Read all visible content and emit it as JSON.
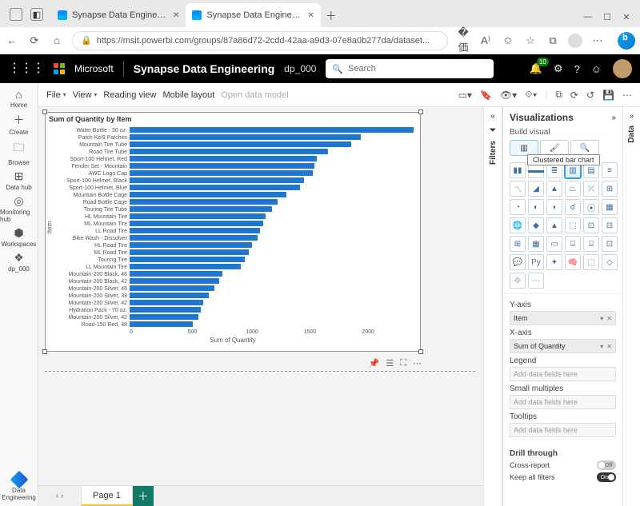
{
  "browser": {
    "tabs": [
      {
        "label": "Synapse Data Engineering",
        "active": false
      },
      {
        "label": "Synapse Data Engineering",
        "active": true
      }
    ],
    "url": "https://msit.powerbi.com/groups/87a86d72-2cdd-42aa-a9d3-07e8a0b277da/dataset..."
  },
  "app_header": {
    "brand": "Microsoft",
    "product": "Synapse Data Engineering",
    "workspace": "dp_000",
    "search_placeholder": "Search",
    "notifications": "10"
  },
  "left_rail": {
    "items": [
      {
        "icon": "⌂",
        "label": "Home"
      },
      {
        "icon": "＋",
        "label": "Create"
      },
      {
        "icon": "🗀",
        "label": "Browse"
      },
      {
        "icon": "⊞",
        "label": "Data hub"
      },
      {
        "icon": "◎",
        "label": "Monitoring hub"
      },
      {
        "icon": "⬢",
        "label": "Workspaces"
      },
      {
        "icon": "❖",
        "label": "dp_000"
      }
    ],
    "bottom_label": "Data Engineering"
  },
  "ribbon": {
    "menus": [
      "File",
      "View",
      "Reading view",
      "Mobile layout",
      "Open data model"
    ]
  },
  "filters_label": "Filters",
  "data_label": "Data",
  "viz_pane": {
    "title": "Visualizations",
    "sub": "Build visual",
    "tooltip": "Clustered bar chart",
    "yaxis_label": "Y-axis",
    "yaxis_value": "Item",
    "xaxis_label": "X-axis",
    "xaxis_value": "Sum of Quantity",
    "legend_label": "Legend",
    "placeholder": "Add data fields here",
    "smallmult_label": "Small multiples",
    "tooltips_label": "Tooltips",
    "drill_label": "Drill through",
    "cross_report": "Cross-report",
    "keep_filters": "Keep all filters",
    "off": "Off",
    "on": "On"
  },
  "page_tab": "Page 1",
  "chart_data": {
    "type": "bar",
    "title": "Sum of Quantity by Item",
    "xlabel": "Sum of Quantity",
    "ylabel": "Item",
    "xlim": [
      0,
      2200
    ],
    "xticks": [
      0,
      500,
      1000,
      1500,
      2000
    ],
    "categories": [
      "Water Bottle - 30 oz.",
      "Patch Kit/8 Patches",
      "Mountain Tire Tube",
      "Road Tire Tube",
      "Sport-100 Helmet, Red",
      "Fender Set - Mountain",
      "AWC Logo Cap",
      "Sport-100 Helmet, Black",
      "Sport-100 Helmet, Blue",
      "Mountain Bottle Cage",
      "Road Bottle Cage",
      "Touring Tire Tube",
      "HL Mountain Tire",
      "ML Mountain Tire",
      "LL Road Tire",
      "Bike Wash - Dissolver",
      "HL Road Tire",
      "ML Road Tire",
      "Touring Tire",
      "LL Mountain Tire",
      "Mountain-200 Black, 46",
      "Mountain-200 Black, 42",
      "Mountain-200 Silver, 46",
      "Mountain-200 Silver, 38",
      "Mountain-200 Silver, 42",
      "Hydration Pack - 70 oz.",
      "Mountain-200 Silver, 42",
      "Road-150 Red, 48"
    ],
    "values": [
      2150,
      1750,
      1680,
      1500,
      1420,
      1400,
      1390,
      1320,
      1290,
      1190,
      1120,
      1080,
      1030,
      1010,
      990,
      970,
      930,
      900,
      870,
      840,
      700,
      680,
      640,
      600,
      560,
      540,
      520,
      480
    ]
  }
}
